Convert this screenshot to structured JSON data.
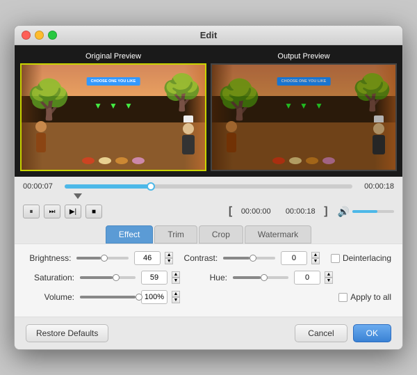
{
  "window": {
    "title": "Edit"
  },
  "titlebar": {
    "close_label": "",
    "min_label": "",
    "max_label": ""
  },
  "preview": {
    "original_label": "Original Preview",
    "output_label": "Output Preview"
  },
  "timeline": {
    "start_time": "00:00:07",
    "end_time": "00:00:18",
    "progress": 30
  },
  "playback": {
    "pause_icon": "⏸",
    "next_frame_icon": "⏭",
    "step_icon": "▶|",
    "stop_icon": "■",
    "time_start": "00:00:00",
    "time_end": "00:00:18"
  },
  "tabs": [
    {
      "id": "effect",
      "label": "Effect",
      "active": true
    },
    {
      "id": "trim",
      "label": "Trim",
      "active": false
    },
    {
      "id": "crop",
      "label": "Crop",
      "active": false
    },
    {
      "id": "watermark",
      "label": "Watermark",
      "active": false
    }
  ],
  "effect": {
    "brightness": {
      "label": "Brightness:",
      "value": "46",
      "min": 0,
      "max": 100
    },
    "contrast": {
      "label": "Contrast:",
      "value": "0"
    },
    "saturation": {
      "label": "Saturation:",
      "value": "59"
    },
    "hue": {
      "label": "Hue:",
      "value": "0"
    },
    "volume": {
      "label": "Volume:",
      "value": "100%"
    },
    "deinterlacing_label": "Deinterlacing",
    "apply_all_label": "Apply to all"
  },
  "buttons": {
    "restore": "Restore Defaults",
    "cancel": "Cancel",
    "ok": "OK"
  }
}
